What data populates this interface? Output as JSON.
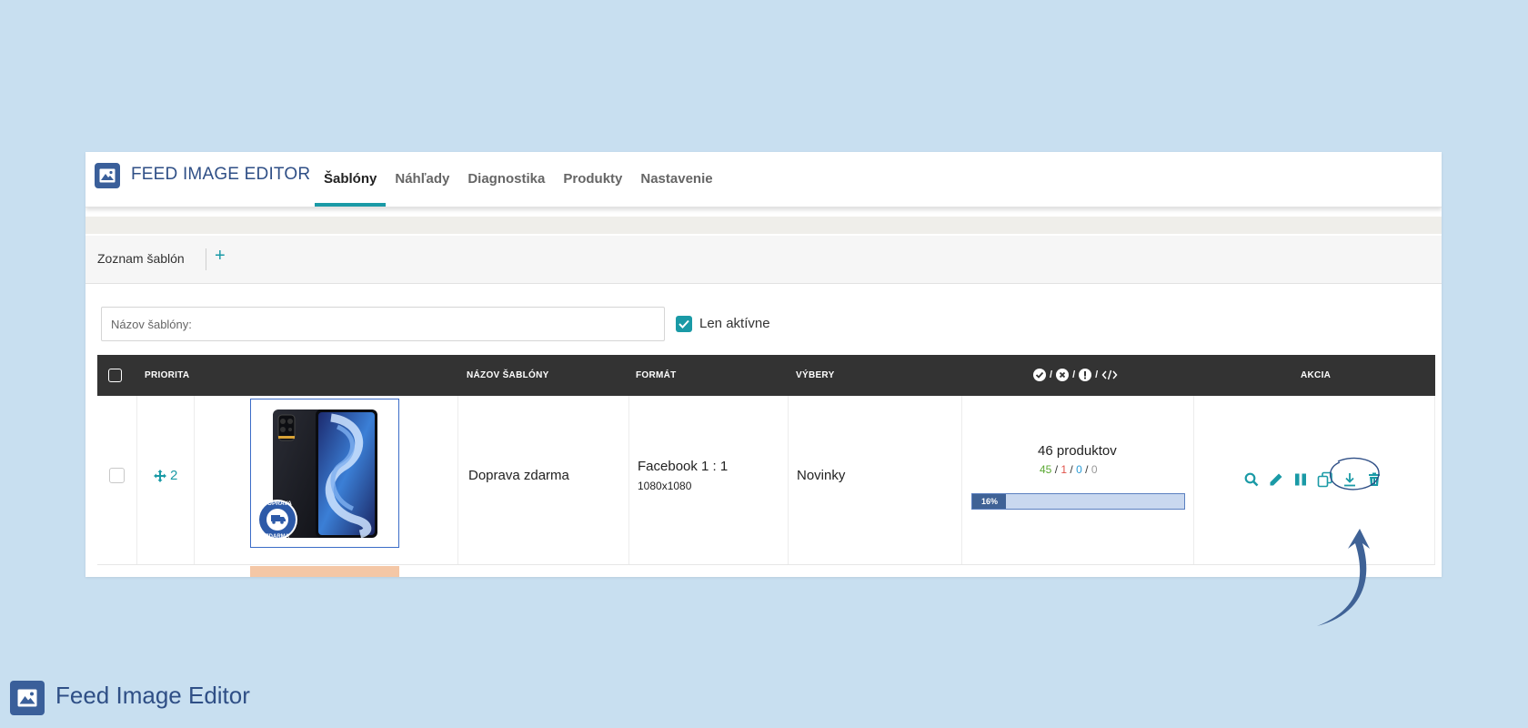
{
  "app": {
    "title": "FEED IMAGE EDITOR",
    "footer_brand": "Feed Image Editor"
  },
  "nav": {
    "tabs": [
      {
        "label": "Šablóny",
        "active": true
      },
      {
        "label": "Náhľady",
        "active": false
      },
      {
        "label": "Diagnostika",
        "active": false
      },
      {
        "label": "Produkty",
        "active": false
      },
      {
        "label": "Nastavenie",
        "active": false
      }
    ]
  },
  "toolbar": {
    "title": "Zoznam šablón",
    "add_label": "+"
  },
  "filter": {
    "search_placeholder": "Názov šablóny:",
    "search_value": "",
    "active_only_label": "Len aktívne",
    "active_only_checked": true
  },
  "table": {
    "columns": {
      "priority": "PRIORITA",
      "name": "NÁZOV ŠABLÓNY",
      "format": "FORMÁT",
      "selections": "VÝBERY",
      "status_sep": "/",
      "action": "AKCIA"
    },
    "rows": [
      {
        "priority": "2",
        "name": "Doprava zdarma",
        "format": "Facebook 1 : 1",
        "format_size": "1080x1080",
        "selection": "Novinky",
        "products": "46 produktov",
        "count_ok": "45",
        "count_error": "1",
        "count_warning": "0",
        "count_code": "0",
        "progress_percent": 16,
        "progress_label": "16%",
        "badge_text_top": "DOPRAVA",
        "badge_text_bottom": "ZDARMA"
      }
    ]
  },
  "colors": {
    "accent": "#1a9aa6",
    "brand": "#2f4f86",
    "header_bg": "#333333",
    "page_bg": "#c8dff0",
    "ok": "#5aa832",
    "error": "#e0524a",
    "info": "#2a9bd6",
    "muted": "#999999"
  },
  "icons": [
    "image-logo-icon",
    "plus-icon",
    "check-icon",
    "move-icon",
    "search-icon",
    "edit-icon",
    "pause-icon",
    "copy-icon",
    "download-icon",
    "trash-icon",
    "check-circle-icon",
    "x-circle-icon",
    "exclamation-circle-icon",
    "code-icon"
  ]
}
